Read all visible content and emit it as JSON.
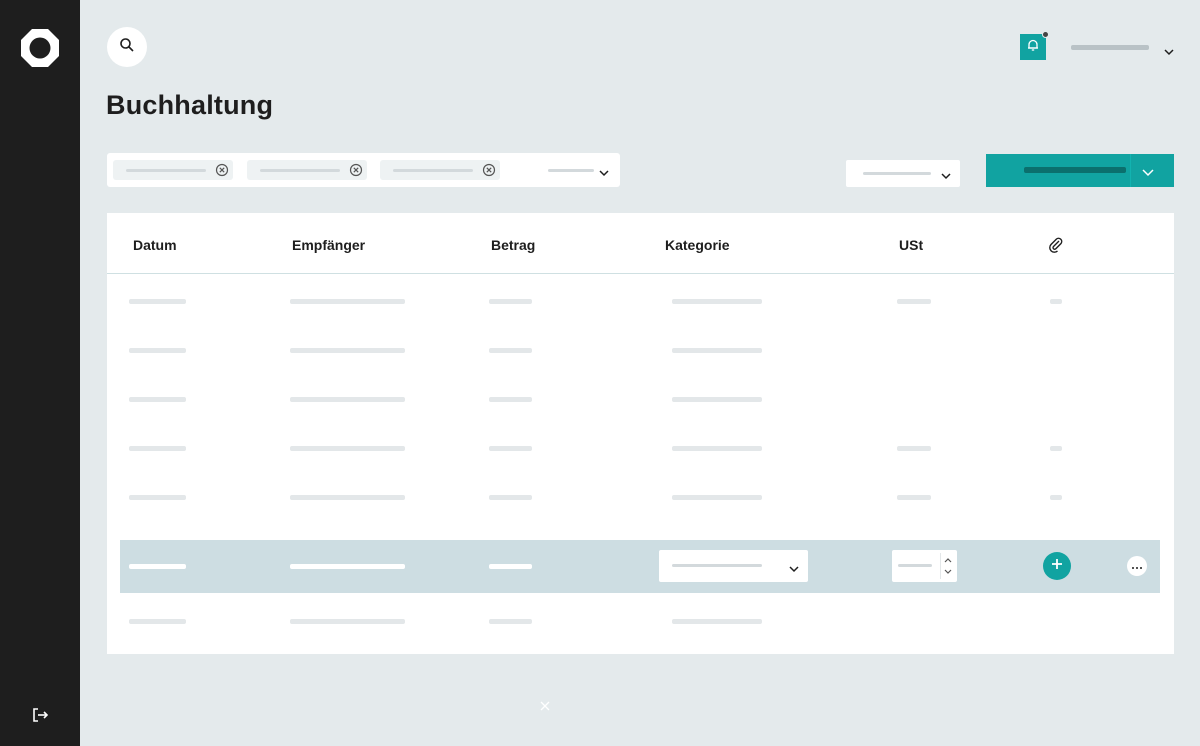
{
  "page": {
    "title": "Buchhaltung"
  },
  "table": {
    "columns": [
      "Datum",
      "Empfänger",
      "Betrag",
      "Kategorie",
      "USt"
    ],
    "attachment_icon": "paperclip-icon"
  },
  "icons": {
    "logo": "app-logo",
    "search": "search-icon",
    "notifications": "bell-icon",
    "logout": "logout-icon"
  },
  "colors": {
    "sidebar": "#1e1e1e",
    "background": "#e4eaec",
    "accent": "#11a3a1",
    "highlight_row": "#cddde2"
  }
}
